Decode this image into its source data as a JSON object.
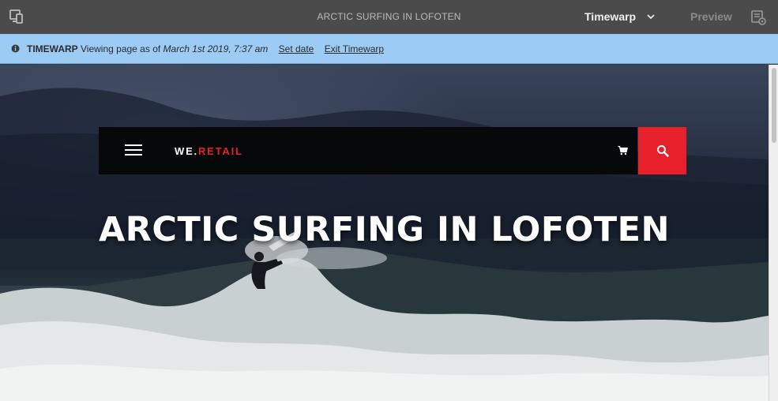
{
  "toolbar": {
    "page_title": "ARCTIC SURFING IN LOFOTEN",
    "mode_label": "Timewarp",
    "preview_label": "Preview",
    "left_icon": "device-emulator-icon",
    "right_icon": "page-properties-icon"
  },
  "timewarp_bar": {
    "tag": "TIMEWARP",
    "message": "Viewing page as of",
    "date": "March 1st 2019, 7:37 am",
    "set_date_label": "Set date",
    "exit_label": "Exit Timewarp",
    "background_color": "#9ccbf5"
  },
  "site": {
    "logo_main": "WE.",
    "logo_accent": "RETAIL",
    "accent_color": "#e8202a",
    "hero_title": "ARCTIC SURFING IN LOFOTEN"
  }
}
